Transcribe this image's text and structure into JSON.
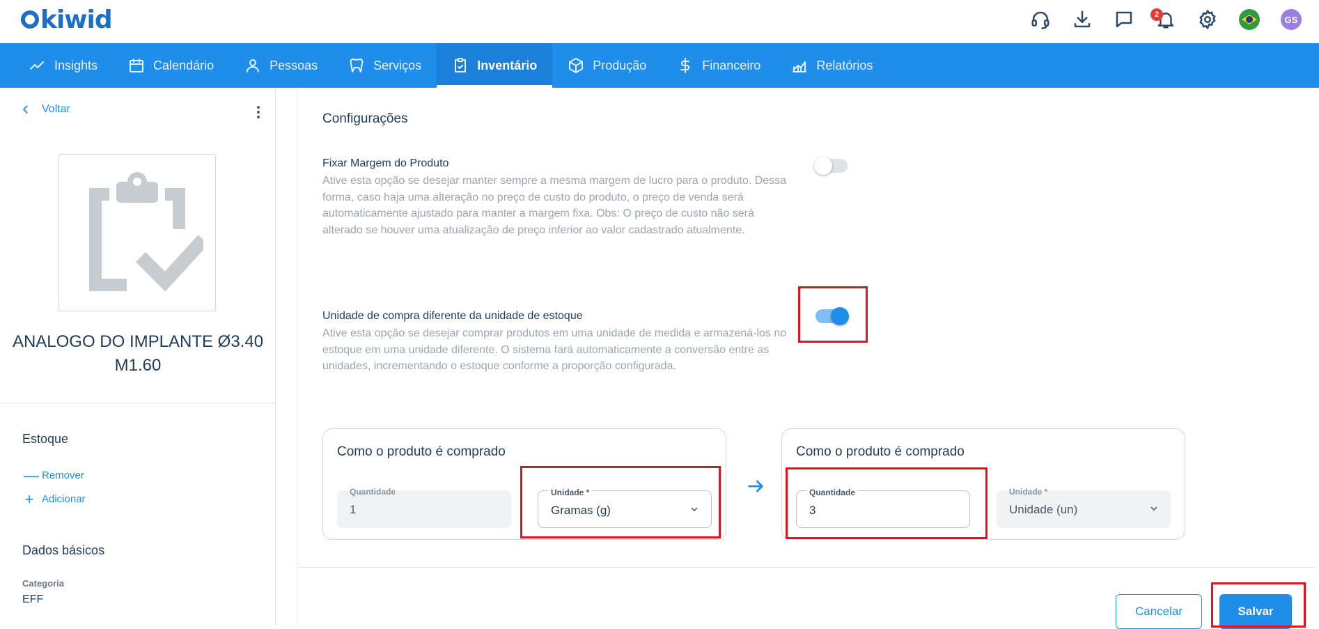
{
  "app": {
    "logo_text": "kiwid"
  },
  "topbar": {
    "notification_count": "2",
    "avatar_initials": "GS",
    "icons": [
      "headset-icon",
      "download-icon",
      "chat-icon",
      "bell-icon",
      "gear-icon",
      "brazil-flag-icon",
      "avatar"
    ]
  },
  "nav": {
    "items": [
      {
        "label": "Insights",
        "icon": "trend-icon"
      },
      {
        "label": "Calendário",
        "icon": "calendar-icon"
      },
      {
        "label": "Pessoas",
        "icon": "person-icon"
      },
      {
        "label": "Serviços",
        "icon": "tooth-icon"
      },
      {
        "label": "Inventário",
        "icon": "clipboard-check-icon",
        "active": true
      },
      {
        "label": "Produção",
        "icon": "box-icon"
      },
      {
        "label": "Financeiro",
        "icon": "dollar-icon"
      },
      {
        "label": "Relatórios",
        "icon": "chart-icon"
      }
    ]
  },
  "sidebar": {
    "back_label": "Voltar",
    "product_name": "ANALOGO DO IMPLANTE Ø3.40 M1.60",
    "stock_title": "Estoque",
    "remove_label": "Remover",
    "add_label": "Adicionar",
    "basic_title": "Dados básicos",
    "category_label": "Categoria",
    "category_value": "EFF"
  },
  "main": {
    "section_title": "Configurações",
    "option1": {
      "title": "Fixar Margem do Produto",
      "description": "Ative esta opção se desejar manter sempre a mesma margem de lucro para o produto. Dessa forma, caso haja uma alteração no preço de custo do produto, o preço de venda será automaticamente ajustado para manter a margem fixa. Obs: O preço de custo não será alterado se houver uma atualização de preço inferior ao valor cadastrado atualmente.",
      "enabled": false
    },
    "option2": {
      "title": "Unidade de compra diferente da unidade de estoque",
      "description": "Ative esta opção se desejar comprar produtos em uma unidade de medida e armazená-los no estoque em uma unidade diferente. O sistema fará automaticamente a conversão entre as unidades, incrementando o estoque conforme a proporção configurada.",
      "enabled": true
    },
    "card_left": {
      "title": "Como o produto é comprado",
      "qty_label": "Quantidade",
      "qty_value": "1",
      "unit_label": "Unidade *",
      "unit_value": "Gramas (g)"
    },
    "card_right": {
      "title": "Como o produto é comprado",
      "qty_label": "Quantidade",
      "qty_value": "3",
      "unit_label": "Unidade *",
      "unit_value": "Unidade (un)"
    },
    "cancel_label": "Cancelar",
    "save_label": "Salvar"
  },
  "colors": {
    "accent": "#1e8eea",
    "highlight": "#e0141e",
    "text": "#1f3b57"
  }
}
